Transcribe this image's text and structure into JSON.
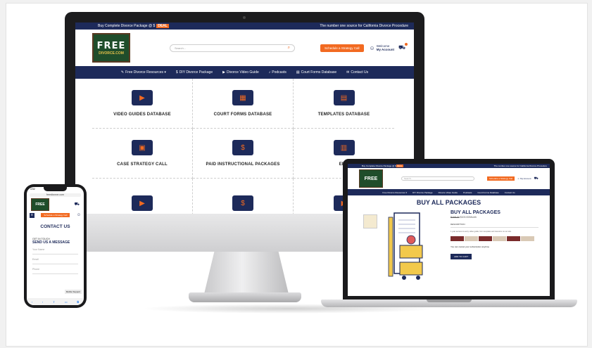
{
  "site": {
    "brand": {
      "line1": "FREE",
      "line2": "DIVORCE.COM"
    },
    "topbar": {
      "promo": "Buy Complete Divorce Package @ $",
      "deal": "DEAL",
      "tagline": "The number one source for California Divorce Procedure"
    },
    "search_placeholder": "Search...",
    "schedule_label": "Schedule a Strategy Call",
    "account": {
      "welcome": "Welcome",
      "label": "My Account"
    },
    "nav": [
      {
        "icon": "✎",
        "label": "Free Divorce Resources ▾"
      },
      {
        "icon": "$",
        "label": "DIY Divorce Package"
      },
      {
        "icon": "▶",
        "label": "Divorce Video Guide"
      },
      {
        "icon": "♪",
        "label": "Podcasts"
      },
      {
        "icon": "▤",
        "label": "Court Forms Database"
      },
      {
        "icon": "✉",
        "label": "Contact Us"
      }
    ],
    "grid": [
      {
        "icon": "▶",
        "label": "VIDEO GUIDES DATABASE"
      },
      {
        "icon": "▦",
        "label": "COURT FORMS DATABASE"
      },
      {
        "icon": "▤",
        "label": "TEMPLATES DATABASE"
      },
      {
        "icon": "▣",
        "label": "CASE STRATEGY CALL"
      },
      {
        "icon": "$",
        "label": "PAID INSTRUCTIONAL PACKAGES"
      },
      {
        "icon": "▥",
        "label": "EBO"
      }
    ]
  },
  "laptop": {
    "page_title": "BUY ALL PACKAGES",
    "product": {
      "title": "BUY ALL PACKAGES",
      "price_old": "$168.00",
      "price": "$100.00/Month",
      "tab": "DESCRIPTION",
      "description": "1 year access to every video guide, form template and resource on our site.",
      "cancel_note": "You can cancel your subscription anytime",
      "add_to_cart": "ADD TO CART"
    }
  },
  "phone": {
    "time": "4:52",
    "url": "freedivorce.com",
    "title": "CONTACT US",
    "get_in_touch": "GET IN TOUCH",
    "send_heading": "SEND US A MESSAGE",
    "fields": [
      "Your Name",
      "Email",
      "Phone"
    ],
    "support": "Mobile Support"
  }
}
